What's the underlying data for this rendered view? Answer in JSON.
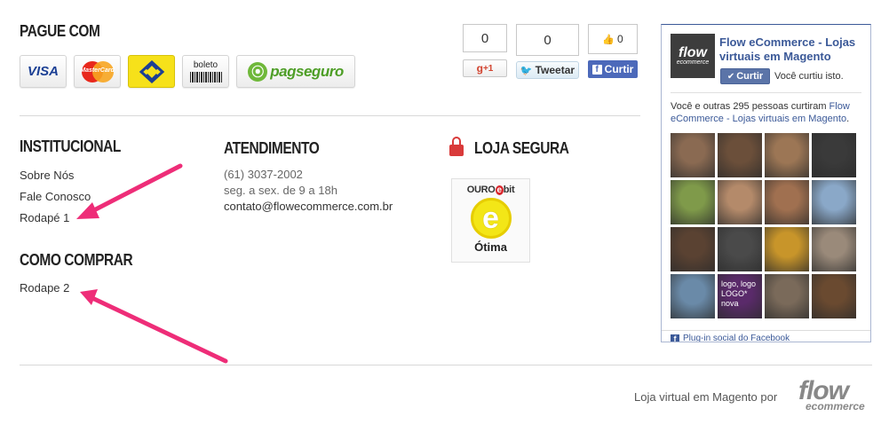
{
  "payment": {
    "heading": "PAGUE COM",
    "cards": [
      {
        "name": "visa",
        "label": "VISA"
      },
      {
        "name": "mastercard",
        "label": "MasterCard"
      },
      {
        "name": "banco-do-brasil",
        "icon": "bb-logo-icon"
      },
      {
        "name": "boleto",
        "label": "boleto"
      },
      {
        "name": "pagseguro",
        "label": "pagseguro"
      }
    ]
  },
  "social": {
    "gplus_count": "0",
    "twitter_count": "0",
    "facebook_count": "0",
    "gplus_label": "+1",
    "tweet_label": "Tweetar",
    "curtir_label": "Curtir"
  },
  "institucional": {
    "heading": "INSTITUCIONAL",
    "links": [
      "Sobre Nós",
      "Fale Conosco",
      "Rodapé 1"
    ]
  },
  "como_comprar": {
    "heading": "COMO COMPRAR",
    "links": [
      "Rodape 2"
    ]
  },
  "atendimento": {
    "heading": "ATENDIMENTO",
    "phone": "(61) 3037-2002",
    "hours": "seg. a sex. de 9 a 18h",
    "email": "contato@flowecommerce.com.br"
  },
  "loja_segura": {
    "heading": "LOJA SEGURA",
    "badge_top_prefix": "OURO",
    "badge_top_e": "e",
    "badge_top_suffix": "bit",
    "badge_letter": "e",
    "badge_rating": "Ótima"
  },
  "facebook_widget": {
    "logo_line1": "flow",
    "logo_line2": "ecommerce",
    "page_name": "Flow eCommerce - Lojas virtuais em Magento",
    "like_label": "Curtir",
    "you_liked": "Você curtiu isto.",
    "others_prefix": "Você e outras 295 pessoas curtiram ",
    "others_page": "Flow eCommerce - Lojas virtuais em Magento",
    "others_suffix": ".",
    "faces": [
      {
        "name": "face-1",
        "color": "#8a6a52"
      },
      {
        "name": "face-2",
        "color": "#6b4f3a"
      },
      {
        "name": "face-3",
        "color": "#9c7655"
      },
      {
        "name": "face-4",
        "color": "#3a3a3a"
      },
      {
        "name": "face-5",
        "color": "#7f9a4a"
      },
      {
        "name": "face-6",
        "color": "#b48a6a"
      },
      {
        "name": "face-7",
        "color": "#a07050"
      },
      {
        "name": "face-8",
        "color": "#8aa8c8"
      },
      {
        "name": "face-9",
        "color": "#5a4232"
      },
      {
        "name": "face-10",
        "color": "#4a4a4a"
      },
      {
        "name": "face-11",
        "color": "#c8952a"
      },
      {
        "name": "face-12",
        "color": "#9a8a7a"
      },
      {
        "name": "face-13",
        "color": "#6a8aa8"
      },
      {
        "name": "face-14",
        "color": "#5a2a6a",
        "text": "logo, logo LOGO* nova"
      },
      {
        "name": "face-15",
        "color": "#7a6a5a"
      },
      {
        "name": "face-16",
        "color": "#6a4a30"
      }
    ],
    "plugin_label": "Plug-in social do Facebook"
  },
  "footer": {
    "text": "Loja virtual em Magento por",
    "logo_line1": "flow",
    "logo_line2": "ecommerce"
  },
  "colors": {
    "arrow": "#ee2d78",
    "facebook": "#3b5998",
    "lock": "#d93a3a"
  }
}
